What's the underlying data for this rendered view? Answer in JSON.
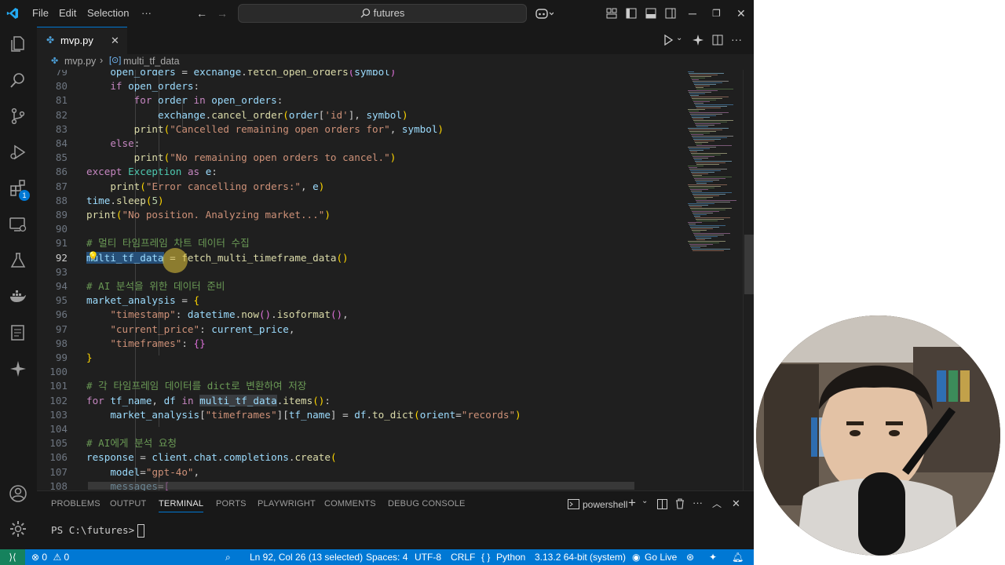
{
  "titlebar": {
    "menus": [
      "File",
      "Edit",
      "Selection",
      "···"
    ],
    "search_text": "futures"
  },
  "tab": {
    "filename": "mvp.py",
    "close_glyph": "✕"
  },
  "breadcrumb": {
    "file": "mvp.py",
    "symbol": "multi_tf_data"
  },
  "activity": {
    "extensions_badge": "1"
  },
  "editor": {
    "lines": [
      {
        "n": "79",
        "html": "         <span class=\"var\">open_orders</span> = <span class=\"var\">exchange</span>.<span class=\"fn\">fetch_open_orders</span><span class=\"br2\">(</span><span class=\"var\">symbol</span><span class=\"br2\">)</span>"
      },
      {
        "n": "80",
        "html": "         <span class=\"ctl\">if</span> <span class=\"var\">open_orders</span>:"
      },
      {
        "n": "81",
        "html": "             <span class=\"ctl\">for</span> <span class=\"var\">order</span> <span class=\"ctl\">in</span> <span class=\"var\">open_orders</span>:"
      },
      {
        "n": "82",
        "html": "                 <span class=\"var\">exchange</span>.<span class=\"fn\">cancel_order</span><span class=\"br1\">(</span><span class=\"var\">order</span>[<span class=\"str\">'id'</span>], <span class=\"var\">symbol</span><span class=\"br1\">)</span>"
      },
      {
        "n": "83",
        "html": "             <span class=\"fn\">print</span><span class=\"br1\">(</span><span class=\"str\">\"Cancelled remaining open orders for\"</span>, <span class=\"var\">symbol</span><span class=\"br1\">)</span>"
      },
      {
        "n": "84",
        "html": "         <span class=\"ctl\">else</span>:"
      },
      {
        "n": "85",
        "html": "             <span class=\"fn\">print</span><span class=\"br1\">(</span><span class=\"str\">\"No remaining open orders to cancel.\"</span><span class=\"br1\">)</span>"
      },
      {
        "n": "86",
        "html": "     <span class=\"ctl\">except</span> <span class=\"cls\">Exception</span> <span class=\"ctl\">as</span> <span class=\"var\">e</span>:"
      },
      {
        "n": "87",
        "html": "         <span class=\"fn\">print</span><span class=\"br1\">(</span><span class=\"str\">\"Error cancelling orders:\"</span>, <span class=\"var\">e</span><span class=\"br1\">)</span>"
      },
      {
        "n": "88",
        "html": "     <span class=\"var\">time</span>.<span class=\"fn\">sleep</span><span class=\"br1\">(</span><span class=\"num\">5</span><span class=\"br1\">)</span>"
      },
      {
        "n": "89",
        "html": "     <span class=\"fn\">print</span><span class=\"br1\">(</span><span class=\"str\">\"No position. Analyzing market...\"</span><span class=\"br1\">)</span>"
      },
      {
        "n": "90",
        "html": ""
      },
      {
        "n": "91",
        "html": "     <span class=\"com\"># 멀티 타임프레임 차트 데이터 수집</span>"
      },
      {
        "n": "92",
        "html": "     <span class=\"var sel\">multi_tf_data</span> = <span class=\"fn\">fetch_multi_timeframe_data</span><span class=\"br1\">()</span>",
        "current": true
      },
      {
        "n": "93",
        "html": ""
      },
      {
        "n": "94",
        "html": "     <span class=\"com\"># AI 분석을 위한 데이터 준비</span>"
      },
      {
        "n": "95",
        "html": "     <span class=\"var\">market_analysis</span> = <span class=\"br1\">{</span>"
      },
      {
        "n": "96",
        "html": "         <span class=\"str\">\"timestamp\"</span>: <span class=\"var\">datetime</span>.<span class=\"fn\">now</span><span class=\"br2\">()</span>.<span class=\"fn\">isoformat</span><span class=\"br2\">()</span>,"
      },
      {
        "n": "97",
        "html": "         <span class=\"str\">\"current_price\"</span>: <span class=\"var\">current_price</span>,"
      },
      {
        "n": "98",
        "html": "         <span class=\"str\">\"timeframes\"</span>: <span class=\"br2\">{}</span>"
      },
      {
        "n": "99",
        "html": "     <span class=\"br1\">}</span>"
      },
      {
        "n": "100",
        "html": ""
      },
      {
        "n": "101",
        "html": "     <span class=\"com\"># 각 타임프레임 데이터를 dict로 변환하여 저장</span>"
      },
      {
        "n": "102",
        "html": "     <span class=\"ctl\">for</span> <span class=\"var\">tf_name</span>, <span class=\"var\">df</span> <span class=\"ctl\">in</span> <span class=\"var hl\">multi_tf_data</span>.<span class=\"fn\">items</span><span class=\"br1\">()</span>:"
      },
      {
        "n": "103",
        "html": "         <span class=\"var\">market_analysis</span>[<span class=\"str\">\"timeframes\"</span>][<span class=\"var\">tf_name</span>] = <span class=\"var\">df</span>.<span class=\"fn\">to_dict</span><span class=\"br1\">(</span><span class=\"var\">orient</span>=<span class=\"str\">\"records\"</span><span class=\"br1\">)</span>"
      },
      {
        "n": "104",
        "html": ""
      },
      {
        "n": "105",
        "html": "     <span class=\"com\"># AI에게 분석 요청</span>"
      },
      {
        "n": "106",
        "html": "     <span class=\"var\">response</span> = <span class=\"var\">client</span>.<span class=\"var\">chat</span>.<span class=\"var\">completions</span>.<span class=\"fn\">create</span><span class=\"br1\">(</span>"
      },
      {
        "n": "107",
        "html": "         <span class=\"var\">model</span>=<span class=\"str\">\"gpt-4o\"</span>,"
      },
      {
        "n": "108",
        "html": "         <span class=\"var\">messages</span>=<span class=\"br2\">[</span>"
      }
    ]
  },
  "panel": {
    "tabs": [
      "PROBLEMS",
      "OUTPUT",
      "TERMINAL",
      "PORTS",
      "PLAYWRIGHT",
      "COMMENTS",
      "DEBUG CONSOLE"
    ],
    "active_tab": "TERMINAL",
    "shell": "powershell",
    "prompt": "PS C:\\futures>"
  },
  "status": {
    "errors": "0",
    "warnings": "0",
    "position": "Ln 92, Col 26 (13 selected)",
    "spaces": "Spaces: 4",
    "encoding": "UTF-8",
    "eol": "CRLF",
    "language": "Python",
    "interpreter": "3.13.2 64-bit (system)",
    "golive": "Go Live"
  },
  "colors": {
    "accent": "#0078d4",
    "editor_bg": "#1f1f1f",
    "chrome_bg": "#181818"
  }
}
